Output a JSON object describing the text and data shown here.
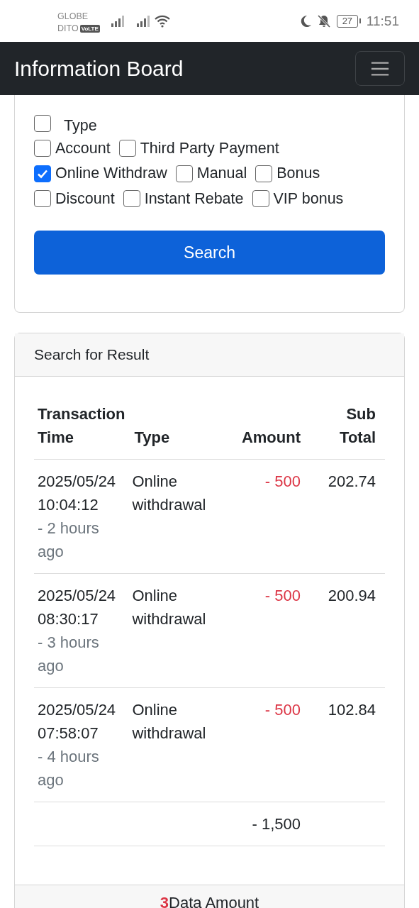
{
  "status_bar": {
    "carrier_1": "GLOBE",
    "carrier_2": "DITO",
    "volte": "VoLTE",
    "battery": "27",
    "time": "11:51"
  },
  "navbar": {
    "title": "Information Board"
  },
  "filters": [
    {
      "label": "Type",
      "checked": false,
      "kind": "header"
    },
    {
      "label": "Account",
      "checked": false,
      "kind": "option"
    },
    {
      "label": "Third Party Payment",
      "checked": false,
      "kind": "option"
    },
    {
      "label": "Online Withdraw",
      "checked": true,
      "kind": "option"
    },
    {
      "label": "Manual",
      "checked": false,
      "kind": "option"
    },
    {
      "label": "Bonus",
      "checked": false,
      "kind": "option"
    },
    {
      "label": "Discount",
      "checked": false,
      "kind": "option"
    },
    {
      "label": "Instant Rebate",
      "checked": false,
      "kind": "option"
    },
    {
      "label": "VIP bonus",
      "checked": false,
      "kind": "option"
    }
  ],
  "search_button": "Search",
  "results": {
    "header": "Search for Result",
    "columns": [
      "Transaction Time",
      "Type",
      "Amount",
      "Sub Total"
    ],
    "rows": [
      {
        "datetime": "2025/05/24 10:04:12",
        "ago": "- 2 hours ago",
        "type": "Online withdrawal",
        "amount": "- 500",
        "sub_total": "202.74"
      },
      {
        "datetime": "2025/05/24 08:30:17",
        "ago": "- 3 hours ago",
        "type": "Online withdrawal",
        "amount": "- 500",
        "sub_total": "200.94"
      },
      {
        "datetime": "2025/05/24 07:58:07",
        "ago": "- 4 hours ago",
        "type": "Online withdrawal",
        "amount": "- 500",
        "sub_total": "102.84"
      }
    ],
    "total_amount": "- 1,500",
    "footer": "**3**Data Amount"
  }
}
